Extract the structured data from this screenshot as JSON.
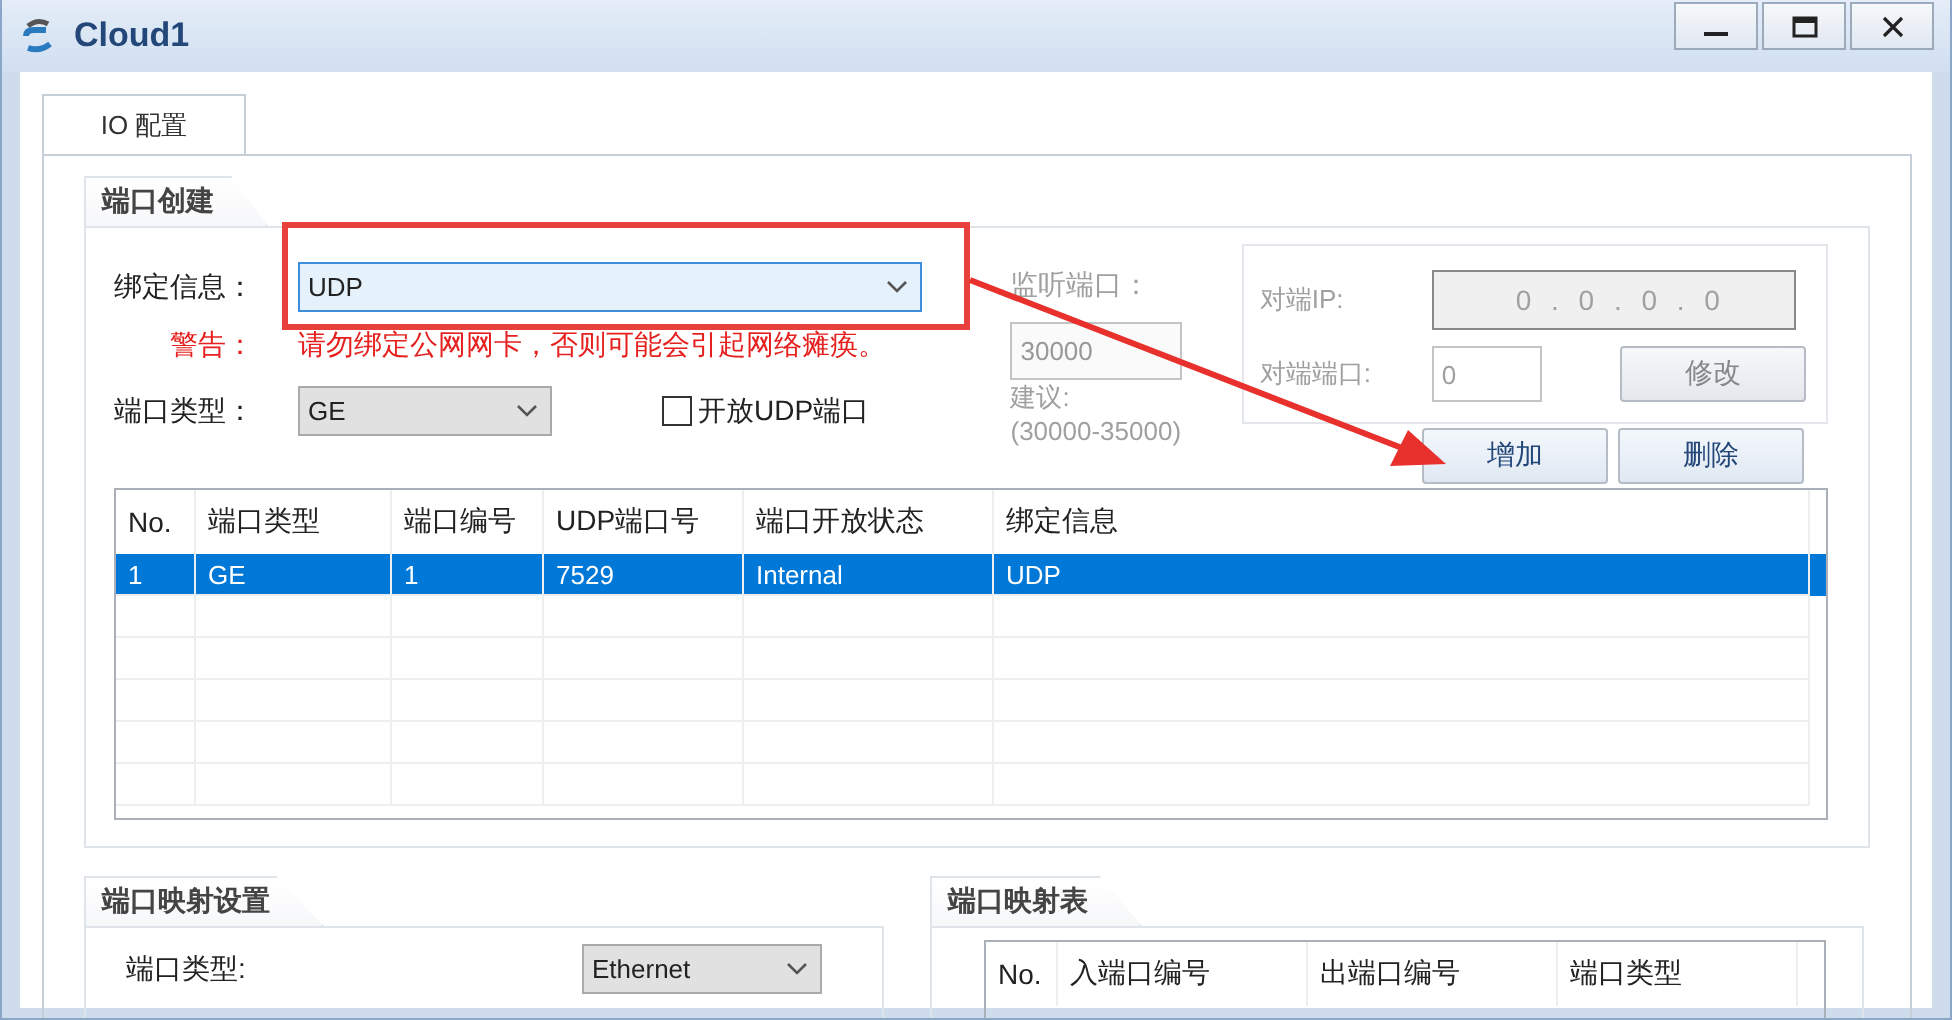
{
  "window": {
    "title": "Cloud1"
  },
  "tabs": [
    {
      "label": "IO 配置",
      "selected": true
    }
  ],
  "port_creation": {
    "title": "端口创建",
    "binding": {
      "label": "绑定信息：",
      "value": "UDP"
    },
    "warning": {
      "label": "警告：",
      "text": "请勿绑定公网网卡，否则可能会引起网络瘫痪。"
    },
    "port_type": {
      "label": "端口类型：",
      "value": "GE"
    },
    "open_udp": {
      "label": "开放UDP端口",
      "checked": false
    },
    "listen_port": {
      "label": "监听端口：",
      "value": "30000",
      "hint_label": "建议:",
      "hint_range": "(30000-35000)",
      "disabled": true
    },
    "peer": {
      "ip_label": "对端IP:",
      "ip": "0 . 0 . 0 . 0",
      "port_label": "对端端口:",
      "port": "0",
      "modify_button": "修改",
      "disabled": true
    },
    "buttons": [
      "增加",
      "删除"
    ],
    "table": {
      "columns": [
        "No.",
        "端口类型",
        "端口编号",
        "UDP端口号",
        "端口开放状态",
        "绑定信息"
      ],
      "rows": [
        {
          "cells": [
            "1",
            "GE",
            "1",
            "7529",
            "Internal",
            "UDP"
          ],
          "selected": true
        }
      ]
    }
  },
  "port_mapping_settings": {
    "title": "端口映射设置",
    "port_type": {
      "label": "端口类型:",
      "value": "Ethernet"
    }
  },
  "port_mapping_table": {
    "title": "端口映射表",
    "columns": [
      "No.",
      "入端口编号",
      "出端口编号",
      "端口类型"
    ]
  }
}
